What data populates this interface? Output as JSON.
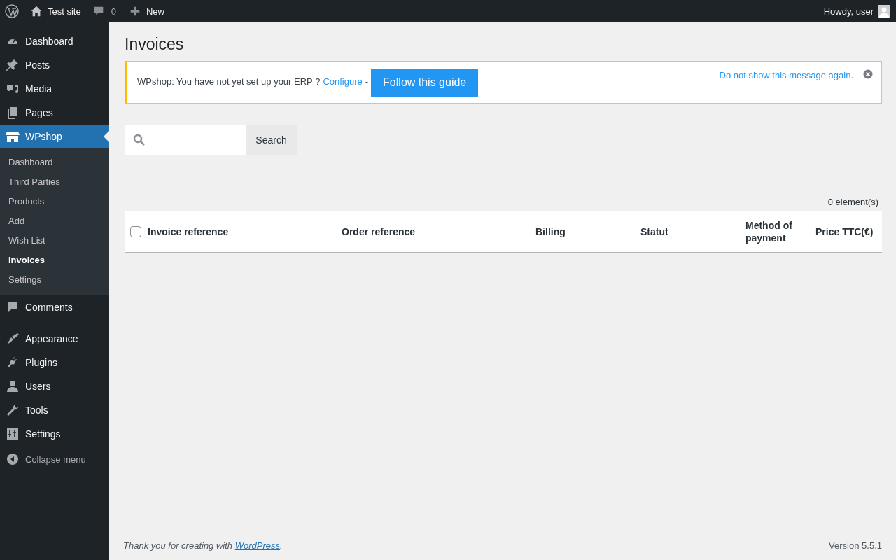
{
  "admin_bar": {
    "site": "Test site",
    "comments": "0",
    "new": "New",
    "greeting": "Howdy, user"
  },
  "sidebar": {
    "groups": [
      [
        {
          "label": "Dashboard",
          "selected": false
        },
        {
          "label": "Posts",
          "selected": false
        },
        {
          "label": "Media",
          "selected": false
        },
        {
          "label": "Pages",
          "selected": false
        },
        {
          "label": "WPshop",
          "selected": true,
          "children": [
            {
              "label": "Dashboard",
              "selected": false
            },
            {
              "label": "Third Parties",
              "selected": false
            },
            {
              "label": "Products",
              "selected": false
            },
            {
              "label": "Add",
              "selected": false
            },
            {
              "label": "Wish List",
              "selected": false
            },
            {
              "label": "Invoices",
              "selected": true
            },
            {
              "label": "Settings",
              "selected": false
            }
          ]
        },
        {
          "label": "Comments",
          "selected": false
        }
      ],
      [
        {
          "label": "Appearance",
          "selected": false
        },
        {
          "label": "Plugins",
          "selected": false
        },
        {
          "label": "Users",
          "selected": false
        },
        {
          "label": "Tools",
          "selected": false
        },
        {
          "label": "Settings",
          "selected": false
        }
      ]
    ],
    "collapse": "Collapse menu"
  },
  "page_title": "Invoices",
  "notice": {
    "text": "WPshop: You have not yet set up your ERP ?",
    "link": "Configure",
    "separator": "-",
    "button": "Follow this guide",
    "dismiss": "Do not show this message again."
  },
  "search": {
    "button": "Search"
  },
  "count": "0 element(s)",
  "table": {
    "select_all": {
      "checked": false
    },
    "columns": [
      "Invoice reference",
      "Order reference",
      "Billing",
      "Statut",
      "Method of payment",
      "Price TTC(€)"
    ]
  },
  "footer": {
    "thanks": "Thank you for creating with",
    "link": "WordPress",
    "end": ".",
    "version": "Version 5.5.1"
  }
}
